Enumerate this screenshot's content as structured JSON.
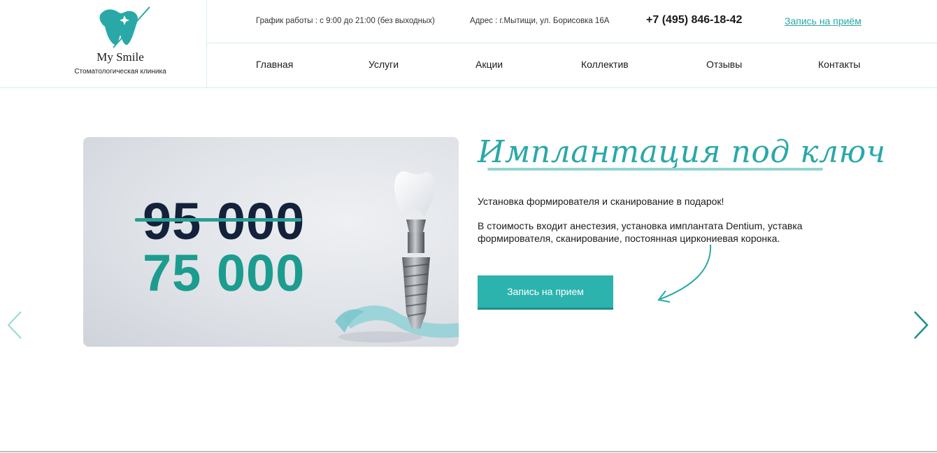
{
  "brand": {
    "name": "My Smile",
    "subtitle": "Стоматологическая клиника",
    "accent": "#2aa8a8"
  },
  "topbar": {
    "schedule": "График работы : с 9:00 до 21:00 (без выходных)",
    "address": "Адрес : г.Мытищи, ул. Борисовка 16А",
    "phone": "+7 (495) 846-18-42",
    "appointment_link": "Запись на приём"
  },
  "nav": {
    "items": [
      {
        "label": "Главная"
      },
      {
        "label": "Услуги"
      },
      {
        "label": "Акции"
      },
      {
        "label": "Коллектив"
      },
      {
        "label": "Отзывы"
      },
      {
        "label": "Контакты"
      }
    ]
  },
  "hero": {
    "old_price": "95 000",
    "new_price": "75 000",
    "title": "Имплантация под ключ",
    "lead": "Установка формирователя и сканирование в подарок!",
    "description": "В стоимость входит анестезия, установка имплантата Dentium, уставка формирователя, сканирование, постоянная циркониевая коронка.",
    "cta_label": "Запись на прием"
  },
  "slider": {
    "prev_icon": "chevron-left-icon",
    "next_icon": "chevron-right-icon"
  }
}
